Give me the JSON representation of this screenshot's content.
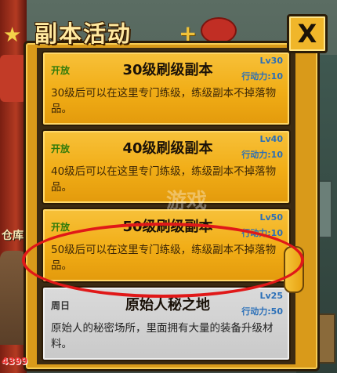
{
  "header": {
    "title": "副本活动",
    "close_label": "X"
  },
  "cards": [
    {
      "status": "开放",
      "name": "30级刷级副本",
      "level": "Lv30",
      "action_points": "行动力:10",
      "description": "30级后可以在这里专门练级，练级副本不掉落物品。"
    },
    {
      "status": "开放",
      "name": "40级刷级副本",
      "level": "Lv40",
      "action_points": "行动力:10",
      "description": "40级后可以在这里专门练级，练级副本不掉落物品。"
    },
    {
      "status": "开放",
      "name": "50级刷级副本",
      "level": "Lv50",
      "action_points": "行动力:10",
      "description": "50级后可以在这里专门练级，练级副本不掉落物品。"
    },
    {
      "status": "周日",
      "name": "原始人秘之地",
      "level": "Lv25",
      "action_points": "行动力:50",
      "description": "原始人的秘密场所，里面拥有大量的装备升级材料。"
    }
  ],
  "background": {
    "warehouse_label": "仓库",
    "plus_label": "+"
  },
  "watermark": "游戏",
  "logo": "4399",
  "colors": {
    "accent": "#f1ad16",
    "frame": "#2b1c08",
    "highlight_ring": "#e01818",
    "level_text": "#2a6fb8"
  }
}
